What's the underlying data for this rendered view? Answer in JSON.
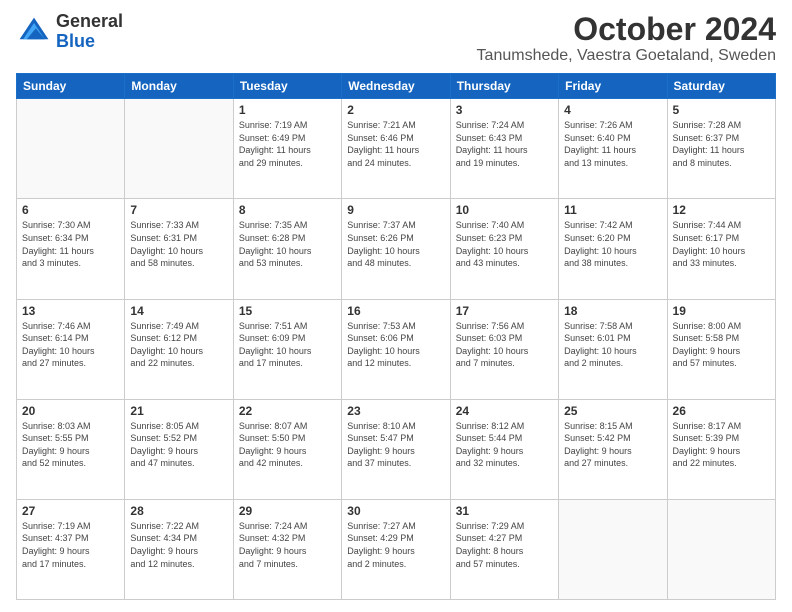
{
  "logo": {
    "line1": "General",
    "line2": "Blue"
  },
  "title": "October 2024",
  "subtitle": "Tanumshede, Vaestra Goetaland, Sweden",
  "weekdays": [
    "Sunday",
    "Monday",
    "Tuesday",
    "Wednesday",
    "Thursday",
    "Friday",
    "Saturday"
  ],
  "weeks": [
    [
      {
        "day": "",
        "detail": ""
      },
      {
        "day": "",
        "detail": ""
      },
      {
        "day": "1",
        "detail": "Sunrise: 7:19 AM\nSunset: 6:49 PM\nDaylight: 11 hours\nand 29 minutes."
      },
      {
        "day": "2",
        "detail": "Sunrise: 7:21 AM\nSunset: 6:46 PM\nDaylight: 11 hours\nand 24 minutes."
      },
      {
        "day": "3",
        "detail": "Sunrise: 7:24 AM\nSunset: 6:43 PM\nDaylight: 11 hours\nand 19 minutes."
      },
      {
        "day": "4",
        "detail": "Sunrise: 7:26 AM\nSunset: 6:40 PM\nDaylight: 11 hours\nand 13 minutes."
      },
      {
        "day": "5",
        "detail": "Sunrise: 7:28 AM\nSunset: 6:37 PM\nDaylight: 11 hours\nand 8 minutes."
      }
    ],
    [
      {
        "day": "6",
        "detail": "Sunrise: 7:30 AM\nSunset: 6:34 PM\nDaylight: 11 hours\nand 3 minutes."
      },
      {
        "day": "7",
        "detail": "Sunrise: 7:33 AM\nSunset: 6:31 PM\nDaylight: 10 hours\nand 58 minutes."
      },
      {
        "day": "8",
        "detail": "Sunrise: 7:35 AM\nSunset: 6:28 PM\nDaylight: 10 hours\nand 53 minutes."
      },
      {
        "day": "9",
        "detail": "Sunrise: 7:37 AM\nSunset: 6:26 PM\nDaylight: 10 hours\nand 48 minutes."
      },
      {
        "day": "10",
        "detail": "Sunrise: 7:40 AM\nSunset: 6:23 PM\nDaylight: 10 hours\nand 43 minutes."
      },
      {
        "day": "11",
        "detail": "Sunrise: 7:42 AM\nSunset: 6:20 PM\nDaylight: 10 hours\nand 38 minutes."
      },
      {
        "day": "12",
        "detail": "Sunrise: 7:44 AM\nSunset: 6:17 PM\nDaylight: 10 hours\nand 33 minutes."
      }
    ],
    [
      {
        "day": "13",
        "detail": "Sunrise: 7:46 AM\nSunset: 6:14 PM\nDaylight: 10 hours\nand 27 minutes."
      },
      {
        "day": "14",
        "detail": "Sunrise: 7:49 AM\nSunset: 6:12 PM\nDaylight: 10 hours\nand 22 minutes."
      },
      {
        "day": "15",
        "detail": "Sunrise: 7:51 AM\nSunset: 6:09 PM\nDaylight: 10 hours\nand 17 minutes."
      },
      {
        "day": "16",
        "detail": "Sunrise: 7:53 AM\nSunset: 6:06 PM\nDaylight: 10 hours\nand 12 minutes."
      },
      {
        "day": "17",
        "detail": "Sunrise: 7:56 AM\nSunset: 6:03 PM\nDaylight: 10 hours\nand 7 minutes."
      },
      {
        "day": "18",
        "detail": "Sunrise: 7:58 AM\nSunset: 6:01 PM\nDaylight: 10 hours\nand 2 minutes."
      },
      {
        "day": "19",
        "detail": "Sunrise: 8:00 AM\nSunset: 5:58 PM\nDaylight: 9 hours\nand 57 minutes."
      }
    ],
    [
      {
        "day": "20",
        "detail": "Sunrise: 8:03 AM\nSunset: 5:55 PM\nDaylight: 9 hours\nand 52 minutes."
      },
      {
        "day": "21",
        "detail": "Sunrise: 8:05 AM\nSunset: 5:52 PM\nDaylight: 9 hours\nand 47 minutes."
      },
      {
        "day": "22",
        "detail": "Sunrise: 8:07 AM\nSunset: 5:50 PM\nDaylight: 9 hours\nand 42 minutes."
      },
      {
        "day": "23",
        "detail": "Sunrise: 8:10 AM\nSunset: 5:47 PM\nDaylight: 9 hours\nand 37 minutes."
      },
      {
        "day": "24",
        "detail": "Sunrise: 8:12 AM\nSunset: 5:44 PM\nDaylight: 9 hours\nand 32 minutes."
      },
      {
        "day": "25",
        "detail": "Sunrise: 8:15 AM\nSunset: 5:42 PM\nDaylight: 9 hours\nand 27 minutes."
      },
      {
        "day": "26",
        "detail": "Sunrise: 8:17 AM\nSunset: 5:39 PM\nDaylight: 9 hours\nand 22 minutes."
      }
    ],
    [
      {
        "day": "27",
        "detail": "Sunrise: 7:19 AM\nSunset: 4:37 PM\nDaylight: 9 hours\nand 17 minutes."
      },
      {
        "day": "28",
        "detail": "Sunrise: 7:22 AM\nSunset: 4:34 PM\nDaylight: 9 hours\nand 12 minutes."
      },
      {
        "day": "29",
        "detail": "Sunrise: 7:24 AM\nSunset: 4:32 PM\nDaylight: 9 hours\nand 7 minutes."
      },
      {
        "day": "30",
        "detail": "Sunrise: 7:27 AM\nSunset: 4:29 PM\nDaylight: 9 hours\nand 2 minutes."
      },
      {
        "day": "31",
        "detail": "Sunrise: 7:29 AM\nSunset: 4:27 PM\nDaylight: 8 hours\nand 57 minutes."
      },
      {
        "day": "",
        "detail": ""
      },
      {
        "day": "",
        "detail": ""
      }
    ]
  ]
}
